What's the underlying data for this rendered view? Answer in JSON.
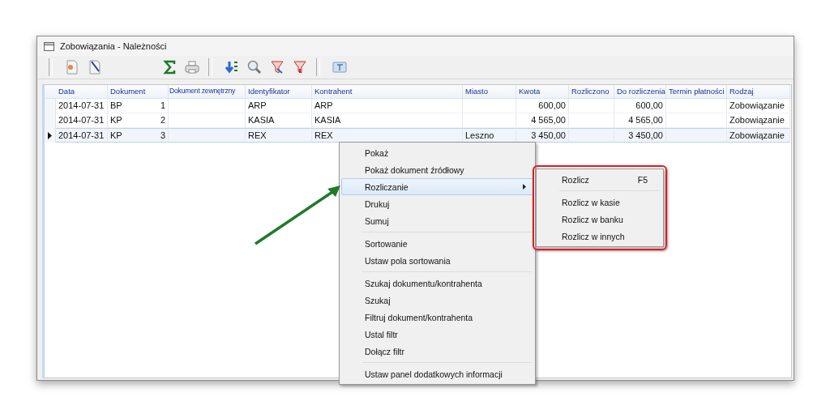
{
  "window": {
    "title": "Zobowiązania - Należności"
  },
  "table": {
    "columns": [
      "Data",
      "Dokument",
      "Dokument zewnętrzny",
      "Identyfikator",
      "Kontrahent",
      "Miasto",
      "Kwota",
      "Rozliczono",
      "Do rozliczenia",
      "Termin płatności",
      "Rodzaj"
    ],
    "rows": [
      {
        "selected": false,
        "doc_number": "1",
        "cells": [
          "2014-07-31",
          "BP",
          "",
          "ARP",
          "ARP",
          "",
          "600,00",
          "",
          "600,00",
          "",
          "Zobowiązanie"
        ]
      },
      {
        "selected": false,
        "doc_number": "2",
        "cells": [
          "2014-07-31",
          "KP",
          "",
          "KASIA",
          "KASIA",
          "",
          "4 565,00",
          "",
          "4 565,00",
          "",
          "Zobowiązanie"
        ]
      },
      {
        "selected": true,
        "doc_number": "3",
        "cells": [
          "2014-07-31",
          "KP",
          "",
          "REX",
          "REX",
          "Leszno",
          "3 450,00",
          "",
          "3 450,00",
          "",
          "Zobowiązanie"
        ]
      }
    ]
  },
  "context_menu": {
    "groups": [
      [
        {
          "label": "Pokaż",
          "selected": false
        },
        {
          "label": "Pokaż dokument źródłowy",
          "selected": false
        },
        {
          "label": "Rozliczanie",
          "selected": true,
          "submenu": true
        },
        {
          "label": "Drukuj",
          "selected": false
        },
        {
          "label": "Sumuj",
          "selected": false
        }
      ],
      [
        {
          "label": "Sortowanie",
          "selected": false
        },
        {
          "label": "Ustaw pola sortowania",
          "selected": false
        }
      ],
      [
        {
          "label": "Szukaj dokumentu/kontrahenta",
          "selected": false
        },
        {
          "label": "Szukaj",
          "selected": false
        },
        {
          "label": "Filtruj dokument/kontrahenta",
          "selected": false
        },
        {
          "label": "Ustal filtr",
          "selected": false
        },
        {
          "label": "Dołącz filtr",
          "selected": false
        }
      ],
      [
        {
          "label": "Ustaw panel dodatkowych informacji",
          "selected": false
        }
      ]
    ]
  },
  "submenu": {
    "groups": [
      [
        {
          "label": "Rozlicz",
          "shortcut": "F5"
        }
      ],
      [
        {
          "label": "Rozlicz w kasie"
        },
        {
          "label": "Rozlicz w banku"
        },
        {
          "label": "Rozlicz w innych"
        }
      ]
    ]
  }
}
